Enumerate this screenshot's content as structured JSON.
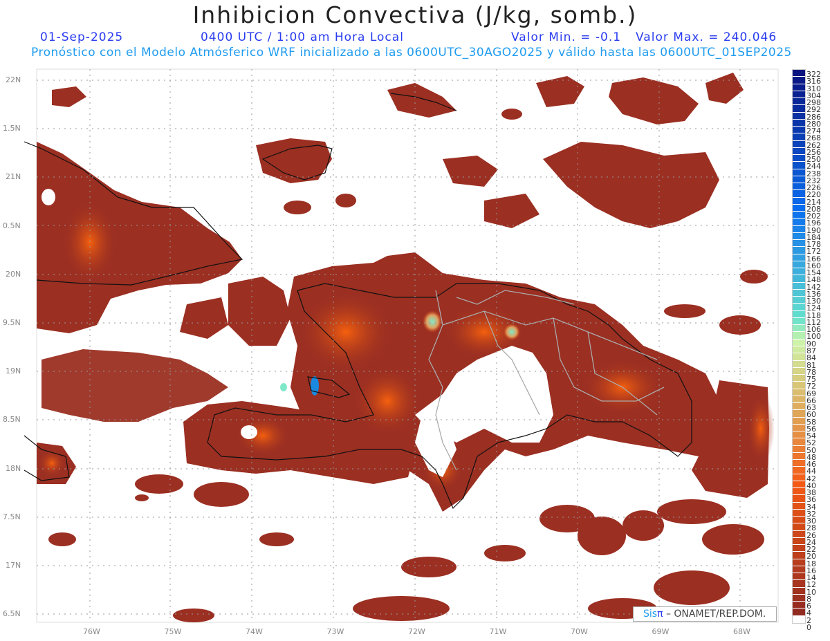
{
  "title": "Inhibicion Convectiva (J/kg, somb.)",
  "date": "01-Sep-2025",
  "time": "0400 UTC / 1:00 am Hora Local",
  "min_label": "Valor Min. = -0.1",
  "max_label": "Valor Max. = 240.046",
  "subtitle": "Pronóstico con el Modelo Atmósferico WRF inicializado a las 0600UTC_30AGO2025 y válido hasta las  0600UTC_01SEP2025",
  "lat_labels": [
    "22N",
    "1.5N",
    "21N",
    "0.5N",
    "20N",
    "9.5N",
    "19N",
    "8.5N",
    "18N",
    "7.5N",
    "17N",
    "6.5N"
  ],
  "lon_labels": [
    "76W",
    "75W",
    "74W",
    "73W",
    "72W",
    "71W",
    "70W",
    "69W",
    "68W"
  ],
  "colorbar": {
    "levels": [
      "322",
      "316",
      "310",
      "304",
      "298",
      "292",
      "286",
      "280",
      "274",
      "268",
      "262",
      "256",
      "250",
      "244",
      "238",
      "232",
      "226",
      "220",
      "214",
      "208",
      "202",
      "196",
      "190",
      "184",
      "178",
      "172",
      "166",
      "160",
      "154",
      "148",
      "142",
      "136",
      "130",
      "124",
      "118",
      "112",
      "106",
      "100",
      "90",
      "87",
      "84",
      "81",
      "78",
      "75",
      "72",
      "69",
      "66",
      "63",
      "60",
      "58",
      "56",
      "54",
      "52",
      "50",
      "48",
      "46",
      "44",
      "42",
      "40",
      "38",
      "36",
      "34",
      "32",
      "30",
      "28",
      "26",
      "24",
      "22",
      "20",
      "18",
      "16",
      "14",
      "12",
      "10",
      "8",
      "6",
      "4",
      "2",
      "0"
    ]
  },
  "logo": {
    "sis": "Sis",
    "pi": "π",
    "rest": " –  ONAMET/REP.DOM."
  },
  "colors": {
    "low": "#9b2f22",
    "mid": "#f5520e",
    "high": "#0a1a80",
    "green": "#c9f5a8"
  }
}
